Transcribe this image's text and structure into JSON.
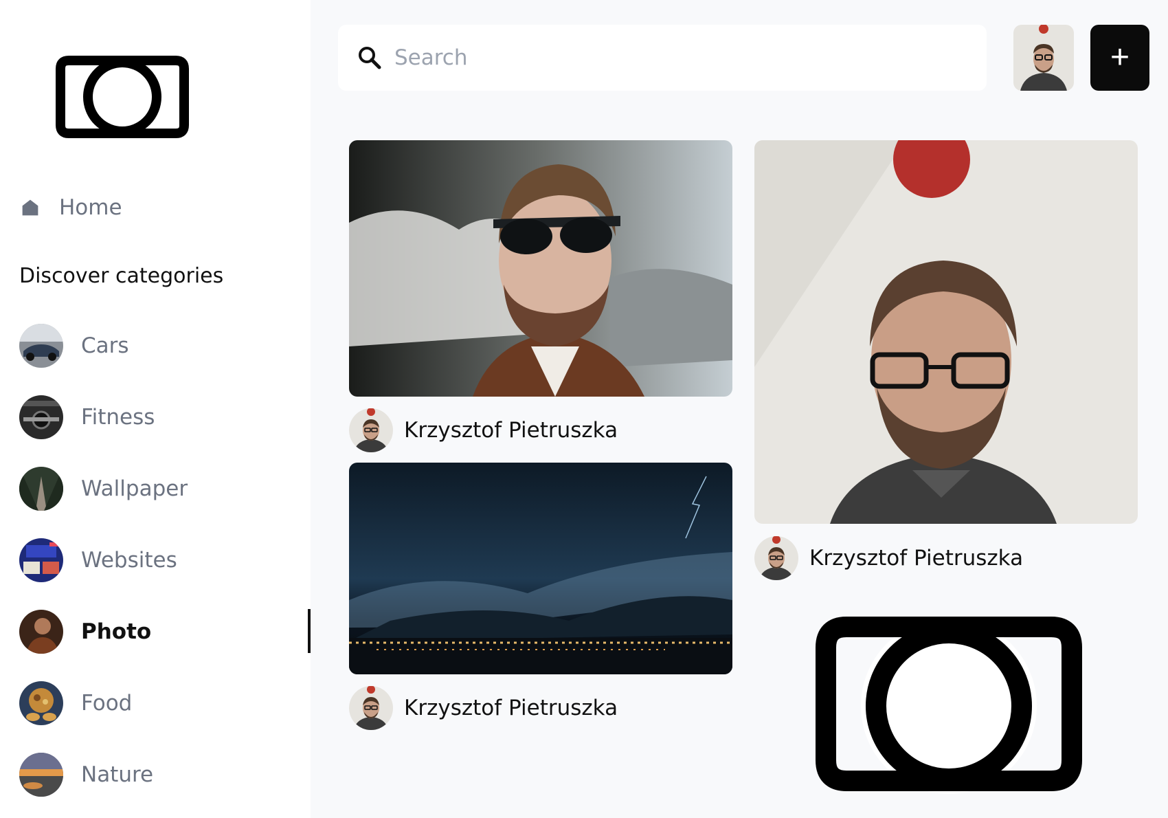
{
  "sidebar": {
    "home_label": "Home",
    "section_title": "Discover categories",
    "categories": [
      {
        "label": "Cars",
        "active": false
      },
      {
        "label": "Fitness",
        "active": false
      },
      {
        "label": "Wallpaper",
        "active": false
      },
      {
        "label": "Websites",
        "active": false
      },
      {
        "label": "Photo",
        "active": true
      },
      {
        "label": "Food",
        "active": false
      },
      {
        "label": "Nature",
        "active": false
      }
    ]
  },
  "topbar": {
    "search_placeholder": "Search",
    "add_button_label": "+"
  },
  "feed": {
    "cards": [
      {
        "author": "Krzysztof Pietruszka",
        "image": "man-sunglasses-portrait"
      },
      {
        "author": "Krzysztof Pietruszka",
        "image": "man-glasses-portrait"
      },
      {
        "author": "Krzysztof Pietruszka",
        "image": "storm-over-city-night"
      }
    ]
  },
  "icons": {
    "logo": "camera-logo-icon",
    "home": "home-icon",
    "search": "search-icon",
    "add": "plus-icon"
  },
  "colors": {
    "sidebar_bg": "#ffffff",
    "main_bg": "#f8f9fb",
    "muted_text": "#6b7280",
    "primary_text": "#111111",
    "button_bg": "#0b0b0b"
  }
}
